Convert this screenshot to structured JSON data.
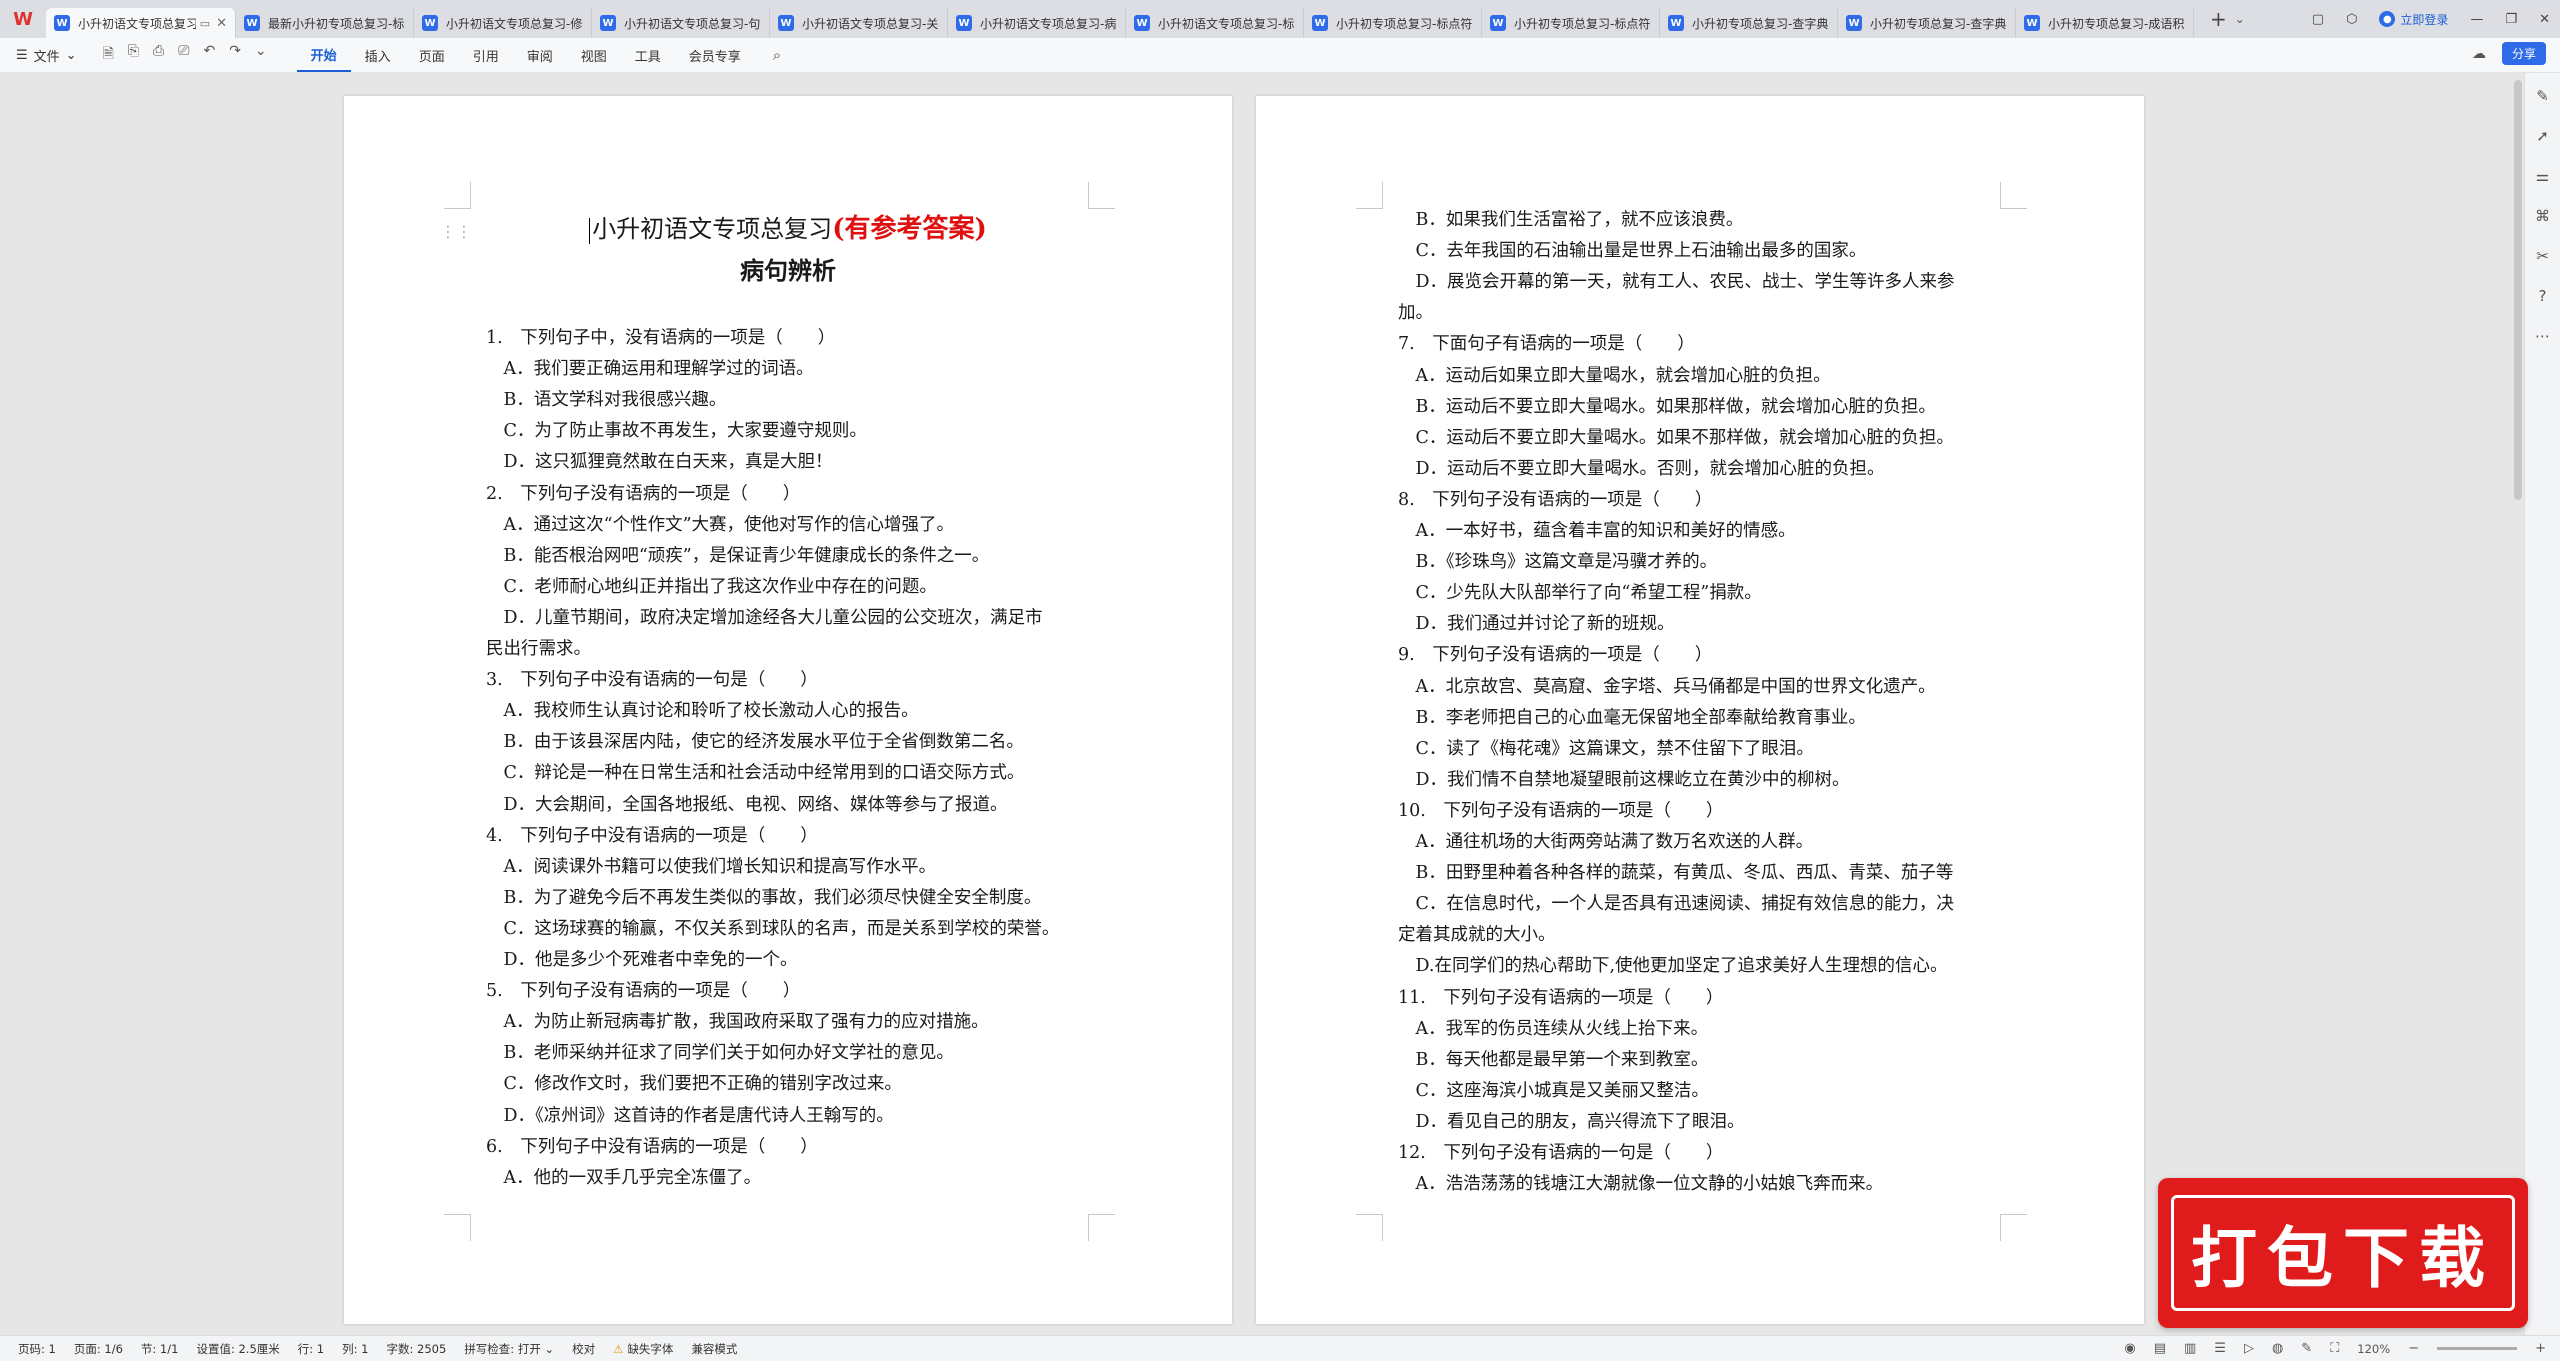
{
  "app": {
    "logo": "W"
  },
  "tabs": [
    {
      "label": "小升初语文专项总复习-",
      "active": true
    },
    {
      "label": "最新小升初专项总复习-标点"
    },
    {
      "label": "小升初语文专项总复习-修辞"
    },
    {
      "label": "小升初语文专项总复习-句式"
    },
    {
      "label": "小升初语文专项总复习-关联"
    },
    {
      "label": "小升初语文专项总复习-病句"
    },
    {
      "label": "小升初语文专项总复习-标点"
    },
    {
      "label": "小升初专项总复习-标点符"
    },
    {
      "label": "小升初专项总复习-标点符"
    },
    {
      "label": "小升初专项总复习-查字典"
    },
    {
      "label": "小升初专项总复习-查字典"
    },
    {
      "label": "小升初专项总复习-成语积"
    }
  ],
  "tabbar": {
    "add": "+",
    "login": "立即登录"
  },
  "ribbon": {
    "file_menu": "文件",
    "tabs": [
      "开始",
      "插入",
      "页面",
      "引用",
      "审阅",
      "视图",
      "工具",
      "会员专享"
    ],
    "share": "分享"
  },
  "document": {
    "title_main": "小升初语文专项总复习",
    "title_red": "(有参考答案)",
    "subtitle": "病句辨析",
    "page1_lines": [
      "1.　下列句子中，没有语病的一项是（　　）",
      "　A．我们要正确运用和理解学过的词语。",
      "　B．语文学科对我很感兴趣。",
      "　C．为了防止事故不再发生，大家要遵守规则。",
      "　D．这只狐狸竟然敢在白天来，真是大胆！",
      "2.　下列句子没有语病的一项是（　　）",
      "　A．通过这次“个性作文”大赛，使他对写作的信心增强了。",
      "　B．能否根治网吧“顽疾”，是保证青少年健康成长的条件之一。",
      "　C．老师耐心地纠正并指出了我这次作业中存在的问题。",
      "　D．儿童节期间，政府决定增加途经各大儿童公园的公交班次，满足市",
      "民出行需求。",
      "3.　下列句子中没有语病的一句是（　　）",
      "　A．我校师生认真讨论和聆听了校长激动人心的报告。",
      "　B．由于该县深居内陆，使它的经济发展水平位于全省倒数第二名。",
      "　C．辩论是一种在日常生活和社会活动中经常用到的口语交际方式。",
      "　D．大会期间，全国各地报纸、电视、网络、媒体等参与了报道。",
      "4.　下列句子中没有语病的一项是（　　）",
      "　A．阅读课外书籍可以使我们增长知识和提高写作水平。",
      "　B．为了避免今后不再发生类似的事故，我们必须尽快健全安全制度。",
      "　C．这场球赛的输赢，不仅关系到球队的名声，而是关系到学校的荣誉。",
      "　D．他是多少个死难者中幸免的一个。",
      "5.　下列句子没有语病的一项是（　　）",
      "　A．为防止新冠病毒扩散，我国政府采取了强有力的应对措施。",
      "　B．老师采纳并征求了同学们关于如何办好文学社的意见。",
      "　C．修改作文时，我们要把不正确的错别字改过来。",
      "　D．《凉州词》这首诗的作者是唐代诗人王翰写的。",
      "6.　下列句子中没有语病的一项是（　　）",
      "　A．他的一双手几乎完全冻僵了。"
    ],
    "page2_lines": [
      "　B．如果我们生活富裕了，就不应该浪费。",
      "　C．去年我国的石油输出量是世界上石油输出最多的国家。",
      "　D．展览会开幕的第一天，就有工人、农民、战士、学生等许多人来参",
      "加。",
      "7.　下面句子有语病的一项是（　　）",
      "　A．运动后如果立即大量喝水，就会增加心脏的负担。",
      "　B．运动后不要立即大量喝水。如果那样做，就会增加心脏的负担。",
      "　C．运动后不要立即大量喝水。如果不那样做，就会增加心脏的负担。",
      "　D．运动后不要立即大量喝水。否则，就会增加心脏的负担。",
      "8.　下列句子没有语病的一项是（　　）",
      "　A．一本好书，蕴含着丰富的知识和美好的情感。",
      "　B．《珍珠鸟》这篇文章是冯骥才养的。",
      "　C．少先队大队部举行了向“希望工程”捐款。",
      "　D．我们通过并讨论了新的班规。",
      "9.　下列句子没有语病的一项是（　　）",
      "　A．北京故宫、莫高窟、金字塔、兵马俑都是中国的世界文化遗产。",
      "　B．李老师把自己的心血毫无保留地全部奉献给教育事业。",
      "　C．读了《梅花魂》这篇课文，禁不住留下了眼泪。",
      "　D．我们情不自禁地凝望眼前这棵屹立在黄沙中的柳树。",
      "10.　下列句子没有语病的一项是（　　）",
      "　A．通往机场的大街两旁站满了数万名欢送的人群。",
      "　B．田野里种着各种各样的蔬菜，有黄瓜、冬瓜、西瓜、青菜、茄子等",
      "　C．在信息时代，一个人是否具有迅速阅读、捕捉有效信息的能力，决",
      "定着其成就的大小。",
      "　D.在同学们的热心帮助下,使他更加坚定了追求美好人生理想的信心。",
      "11.　下列句子没有语病的一项是（　　）",
      "　A．我军的伤员连续从火线上抬下来。",
      "　B．每天他都是最早第一个来到教室。",
      "　C．这座海滨小城真是又美丽又整洁。",
      "　D．看见自己的朋友，高兴得流下了眼泪。",
      "12.　下列句子没有语病的一句是（　　）",
      "　A．浩浩荡荡的钱塘江大潮就像一位文静的小姑娘飞奔而来。"
    ]
  },
  "banner": {
    "text": "打包下载"
  },
  "status": {
    "page_no": "页码: 1",
    "page_count": "页面: 1/6",
    "section": "节: 1/1",
    "setting": "设置值: 2.5厘米",
    "row": "行: 1",
    "col": "列: 1",
    "words": "字数: 2505",
    "spell": "拼写检查: 打开",
    "proof": "校对",
    "missing_font": "缺失字体",
    "compat": "兼容模式",
    "zoom": "120%"
  }
}
